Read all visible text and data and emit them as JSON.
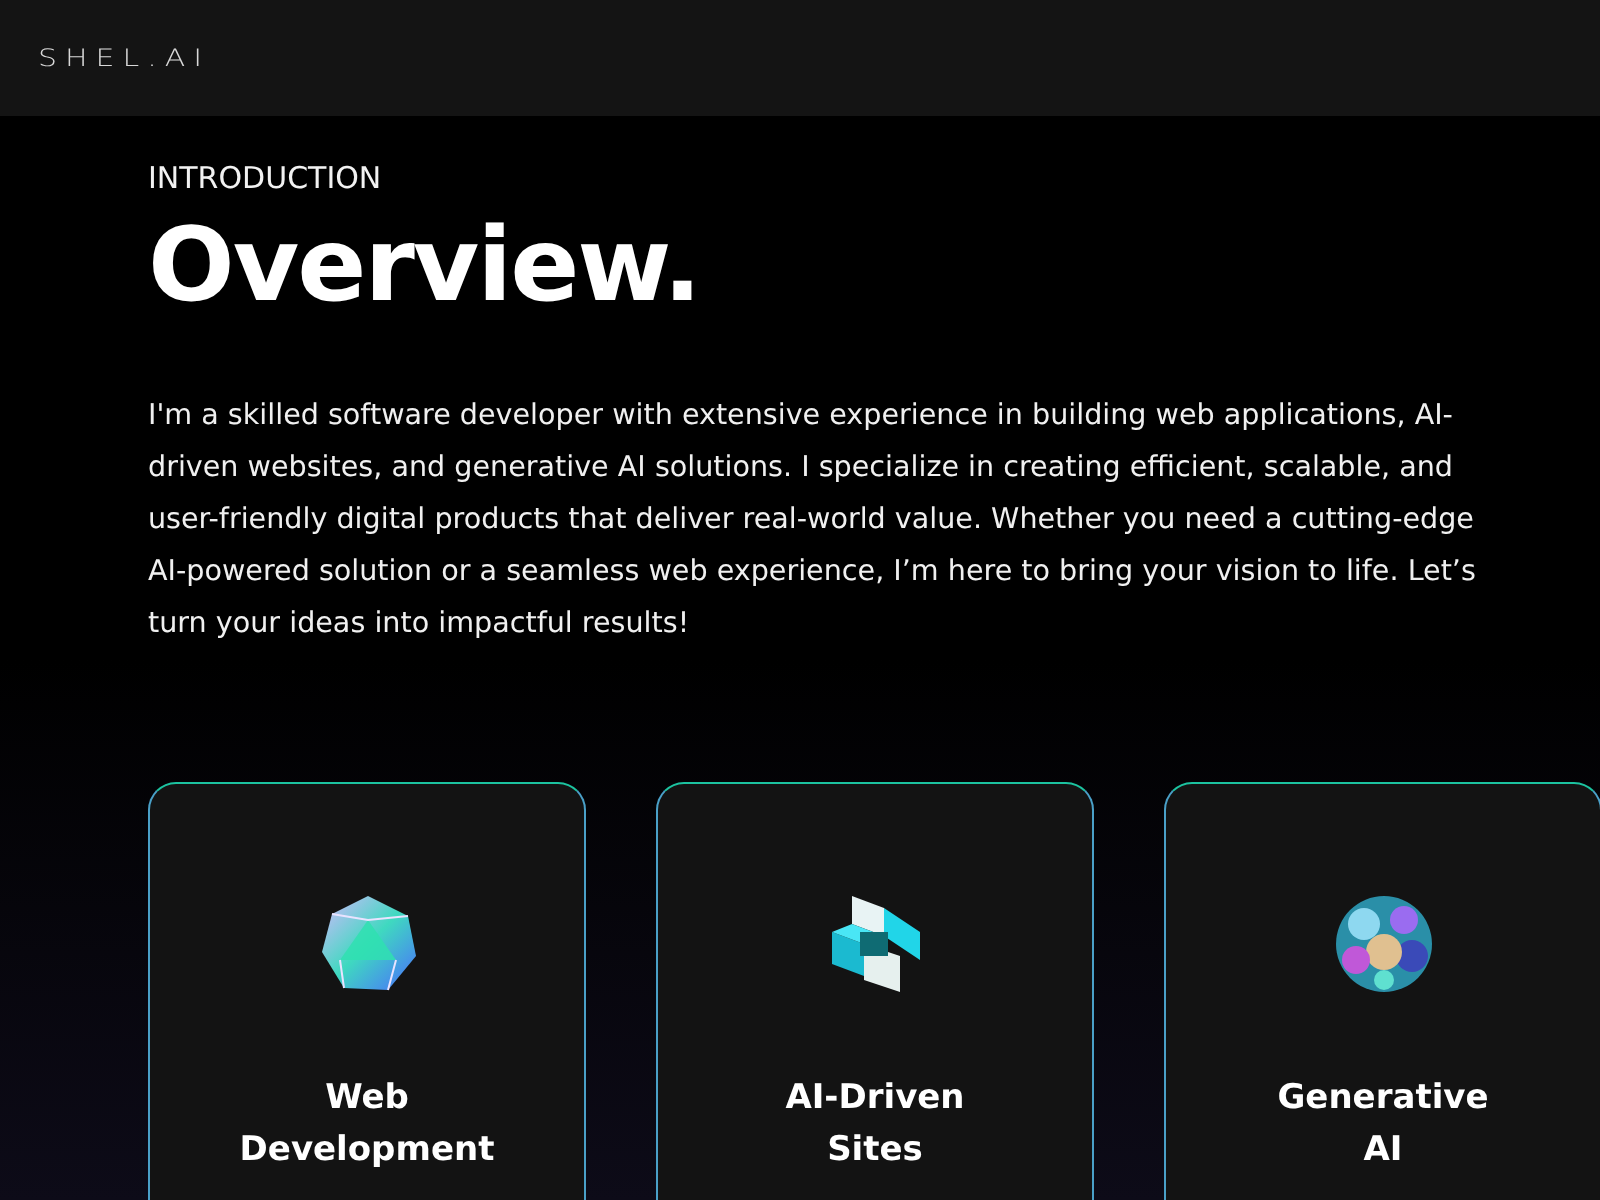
{
  "header": {
    "logo": "SHEL.AI"
  },
  "intro": {
    "eyebrow": "INTRODUCTION",
    "title": "Overview.",
    "text": "I'm a skilled software developer with extensive experience in building web applications, AI-driven websites, and generative AI solutions. I specialize in creating efficient, scalable, and user-friendly digital products that deliver real-world value. Whether you need a cutting-edge AI-powered solution or a seamless web experience, I’m here to bring your vision to life. Let’s turn your ideas into impactful results!"
  },
  "cards": [
    {
      "kind": "polyhedron",
      "title": "Web Development"
    },
    {
      "kind": "knot",
      "title": "AI-Driven Sites"
    },
    {
      "kind": "sphere",
      "title": "Generative AI"
    }
  ]
}
